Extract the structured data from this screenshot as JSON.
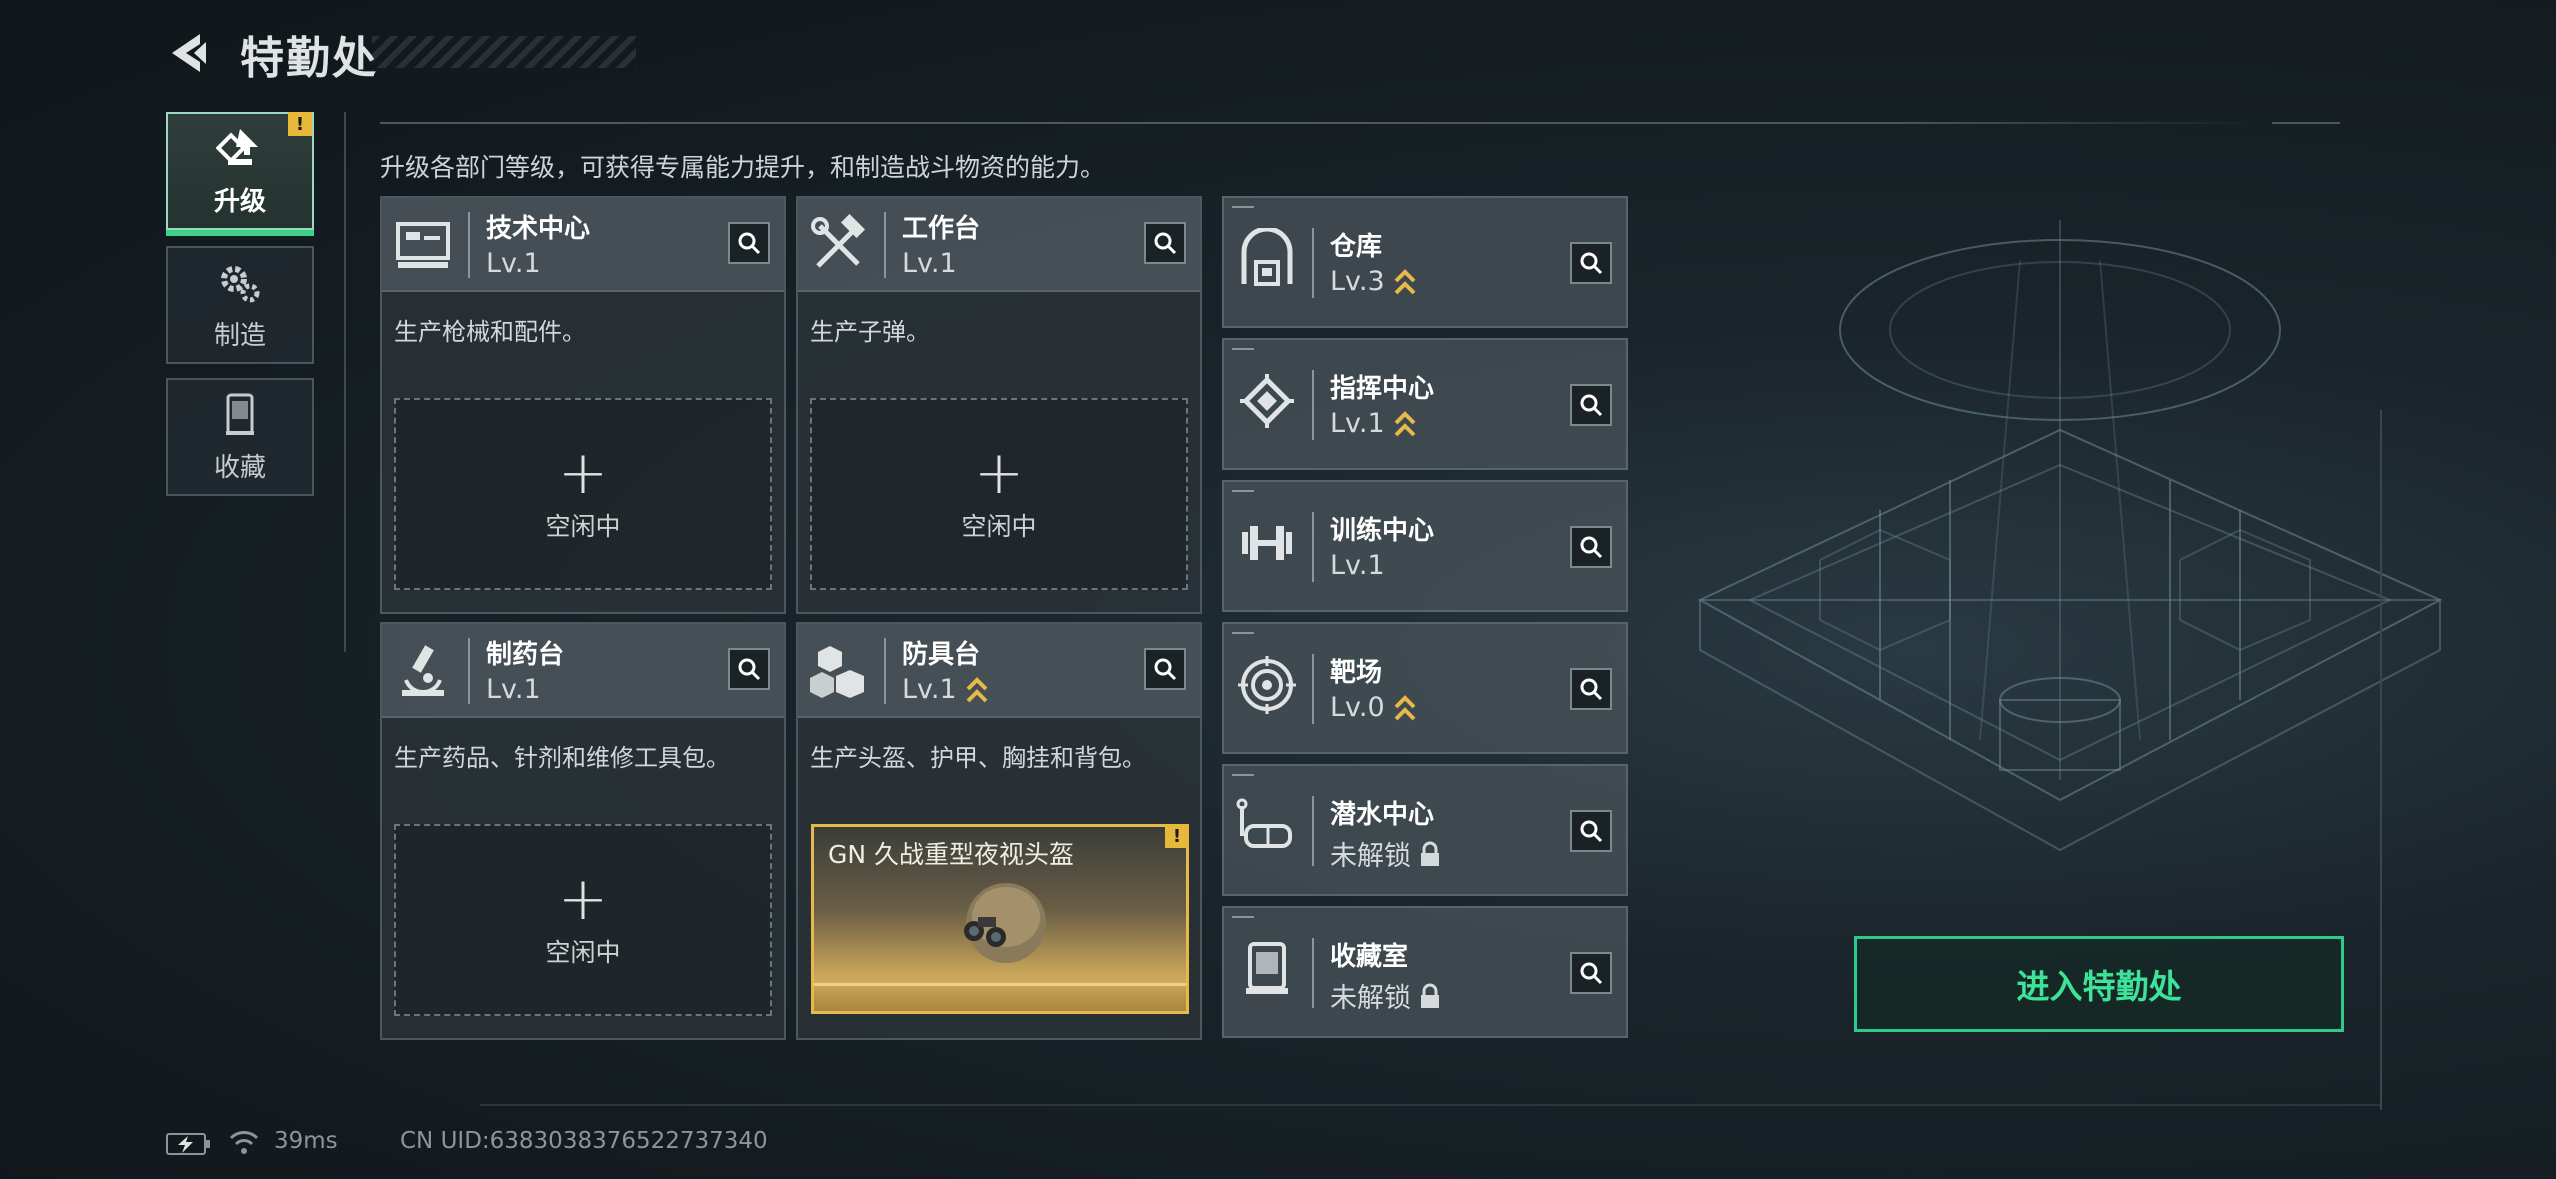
{
  "header": {
    "title": "特勤处"
  },
  "nav": [
    {
      "label": "升级",
      "icon": "upgrade-icon",
      "active": true,
      "badge": "!"
    },
    {
      "label": "制造",
      "icon": "gears-icon",
      "active": false
    },
    {
      "label": "收藏",
      "icon": "display-case-icon",
      "active": false
    }
  ],
  "subtitle": "升级各部门等级，可获得专属能力提升，和制造战斗物资的能力。",
  "large_cards": [
    {
      "name": "技术中心",
      "level": "Lv.1",
      "desc": "生产枪械和配件。",
      "slot": {
        "plus": "+",
        "label": "空闲中"
      }
    },
    {
      "name": "工作台",
      "level": "Lv.1",
      "desc": "生产子弹。",
      "slot": {
        "plus": "+",
        "label": "空闲中"
      }
    },
    {
      "name": "制药台",
      "level": "Lv.1",
      "desc": "生产药品、针剂和维修工具包。",
      "slot": {
        "plus": "+",
        "label": "空闲中"
      }
    },
    {
      "name": "防具台",
      "level": "Lv.1",
      "desc": "生产头盔、护甲、胸挂和背包。",
      "item": {
        "name": "GN 久战重型夜视头盔",
        "badge": "!"
      }
    }
  ],
  "small_cards": [
    {
      "name": "仓库",
      "level": "Lv.3",
      "upgradable": true
    },
    {
      "name": "指挥中心",
      "level": "Lv.1",
      "upgradable": true
    },
    {
      "name": "训练中心",
      "level": "Lv.1",
      "upgradable": false
    },
    {
      "name": "靶场",
      "level": "Lv.0",
      "upgradable": true
    },
    {
      "name": "潜水中心",
      "level": "未解锁",
      "locked": true
    },
    {
      "name": "收藏室",
      "level": "未解锁",
      "locked": true
    }
  ],
  "enter_button": "进入特勤处",
  "status": {
    "ping": "39ms",
    "uid": "CN UID:638303837652273734​0"
  },
  "colors": {
    "accent": "#3ee39a",
    "badge": "#e8b83a",
    "upgrade": "#e6b94a"
  }
}
